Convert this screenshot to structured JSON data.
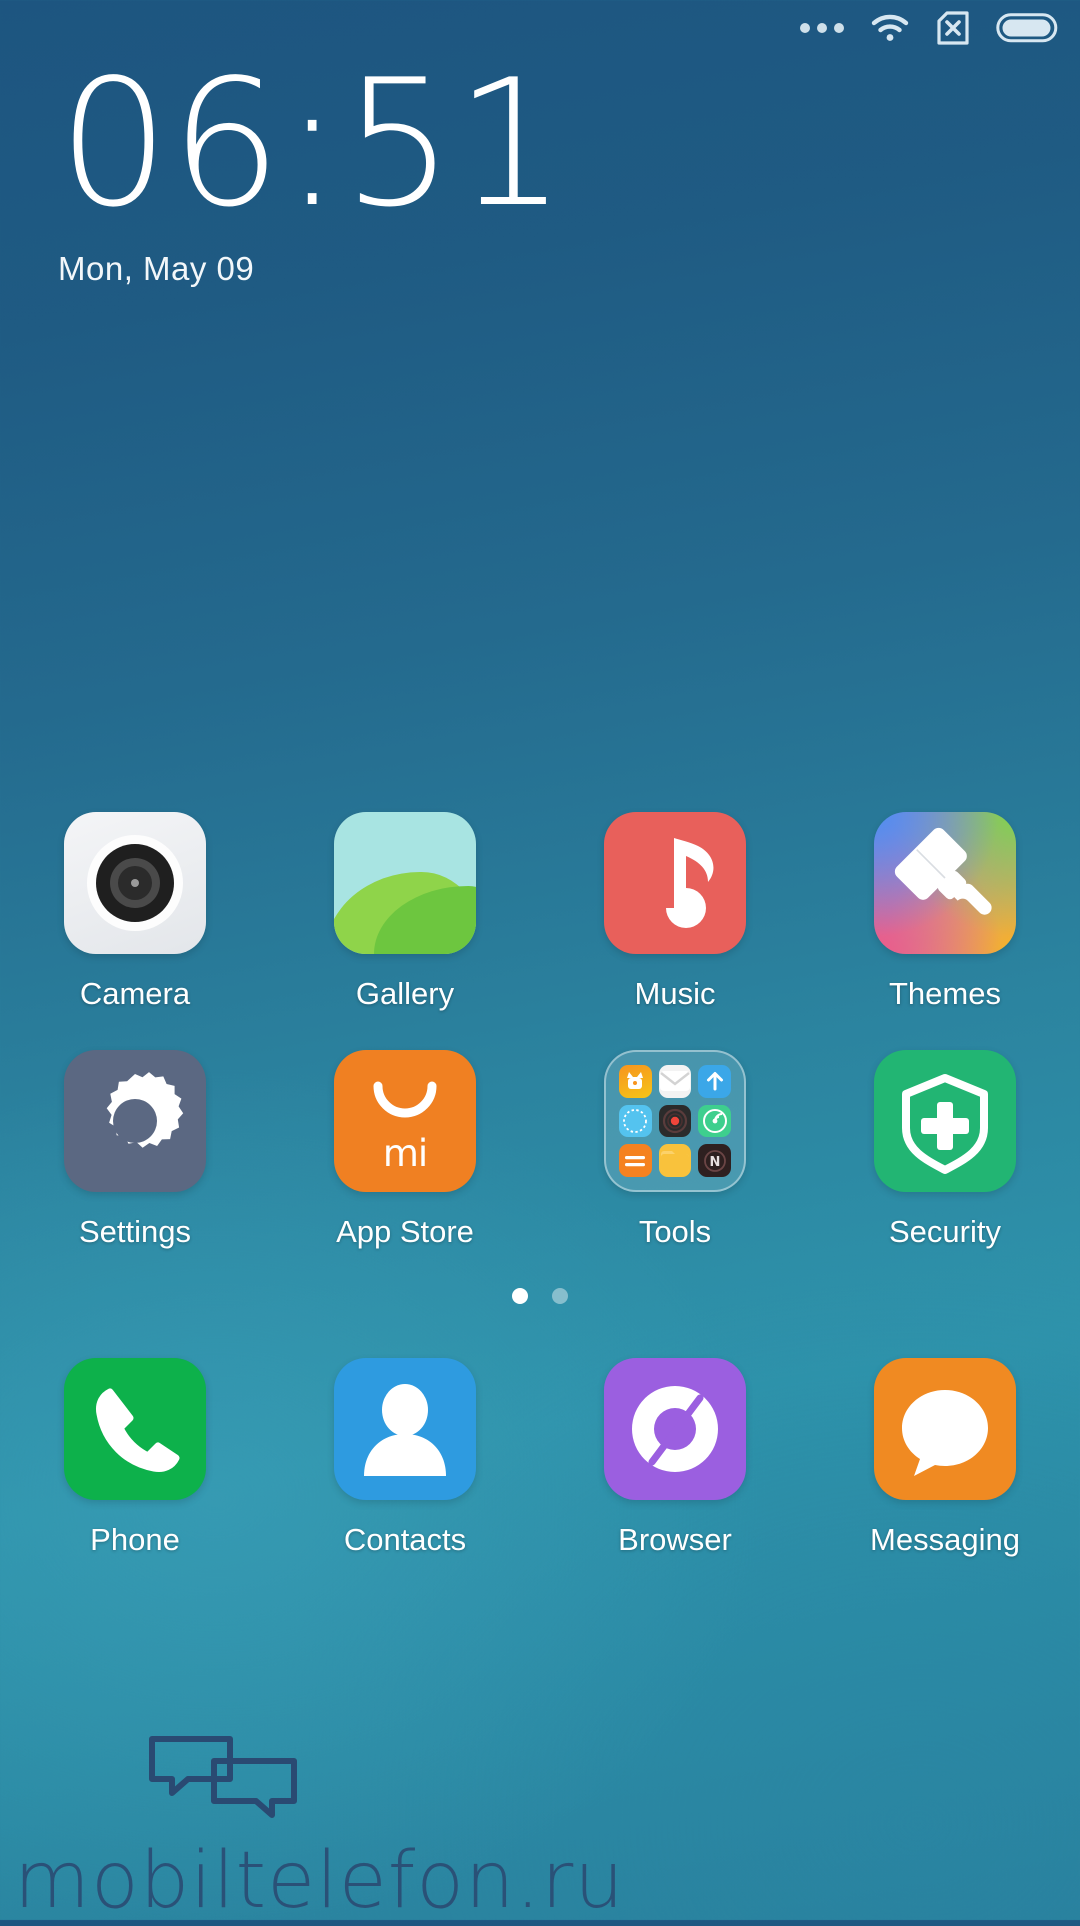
{
  "statusbar": {
    "icons": [
      {
        "name": "more-notifications-icon",
        "label": "•••"
      },
      {
        "name": "wifi-icon",
        "label": "wifi"
      },
      {
        "name": "no-sim-icon",
        "label": "no-sim"
      },
      {
        "name": "battery-icon",
        "label": "battery-full"
      }
    ]
  },
  "clock_widget": {
    "time": "06:51",
    "date": "Mon, May 09"
  },
  "home": {
    "row1": [
      {
        "name": "camera",
        "label": "Camera"
      },
      {
        "name": "gallery",
        "label": "Gallery"
      },
      {
        "name": "music",
        "label": "Music"
      },
      {
        "name": "themes",
        "label": "Themes"
      }
    ],
    "row2": [
      {
        "name": "settings",
        "label": "Settings"
      },
      {
        "name": "app-store",
        "label": "App Store"
      },
      {
        "name": "tools",
        "label": "Tools"
      },
      {
        "name": "security",
        "label": "Security"
      }
    ],
    "dock": [
      {
        "name": "phone",
        "label": "Phone"
      },
      {
        "name": "contacts",
        "label": "Contacts"
      },
      {
        "name": "browser",
        "label": "Browser"
      },
      {
        "name": "messaging",
        "label": "Messaging"
      }
    ],
    "folder_tools": {
      "items": [
        {
          "name": "mi-explorer-icon",
          "color": "#f7941e",
          "glyph": ""
        },
        {
          "name": "mail-icon",
          "color": "#f3f3f3",
          "glyph": ""
        },
        {
          "name": "updater-icon",
          "color": "#3ba7e8",
          "glyph": "↑"
        },
        {
          "name": "compass-icon",
          "color": "#54c3ef",
          "glyph": ""
        },
        {
          "name": "recorder-icon",
          "color": "#2b2b2b",
          "glyph": ""
        },
        {
          "name": "scanner-icon",
          "color": "#3ecf8e",
          "glyph": ""
        },
        {
          "name": "calculator-icon",
          "color": "#f58220",
          "glyph": "="
        },
        {
          "name": "file-manager-icon",
          "color": "#f9c23c",
          "glyph": ""
        },
        {
          "name": "notes-icon",
          "color": "#2e2020",
          "glyph": "N"
        }
      ]
    }
  },
  "page_indicator": {
    "total": 2,
    "active": 1
  },
  "watermark": {
    "text": "mobiltelefon.ru"
  },
  "colors": {
    "music": "#e8605b",
    "settings": "#5b6882",
    "app_store": "#f08022",
    "security": "#22b573",
    "phone": "#0db14b",
    "contacts": "#2e9be0",
    "browser": "#9b5fe0",
    "messaging": "#f08a22",
    "wallpaper_top": "#1d5580",
    "wallpaper_bottom": "#2e93ab"
  }
}
